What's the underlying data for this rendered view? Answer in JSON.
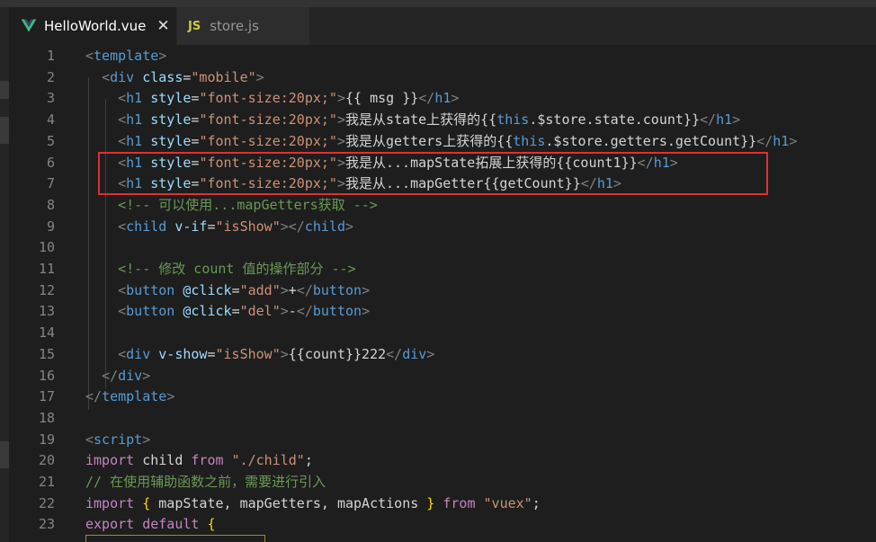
{
  "tabs": [
    {
      "label": "HelloWorld.vue",
      "icon": "vue-icon",
      "active": true,
      "close": "✕"
    },
    {
      "label": "store.js",
      "icon_text": "JS",
      "active": false
    }
  ],
  "colors": {
    "highlight_box": "#e03030",
    "vue_green": "#41b883",
    "js_yellow": "#cbcb41"
  },
  "lines": [
    {
      "n": "1",
      "tokens": [
        [
          "t-bracket",
          "<"
        ],
        [
          "t-tag",
          "template"
        ],
        [
          "t-bracket",
          ">"
        ]
      ]
    },
    {
      "n": "2",
      "tokens": [
        [
          "t-text",
          "  "
        ],
        [
          "t-bracket",
          "<"
        ],
        [
          "t-tag",
          "div"
        ],
        [
          "t-text",
          " "
        ],
        [
          "t-attr",
          "class"
        ],
        [
          "t-text",
          "="
        ],
        [
          "t-str",
          "\"mobile\""
        ],
        [
          "t-bracket",
          ">"
        ]
      ]
    },
    {
      "n": "3",
      "tokens": [
        [
          "t-text",
          "    "
        ],
        [
          "t-bracket",
          "<"
        ],
        [
          "t-tag",
          "h1"
        ],
        [
          "t-text",
          " "
        ],
        [
          "t-attr",
          "style"
        ],
        [
          "t-text",
          "="
        ],
        [
          "t-str",
          "\"font-size:20px;\""
        ],
        [
          "t-bracket",
          ">"
        ],
        [
          "t-text",
          "{{ msg }}"
        ],
        [
          "t-bracket",
          "</"
        ],
        [
          "t-tag",
          "h1"
        ],
        [
          "t-bracket",
          ">"
        ]
      ]
    },
    {
      "n": "4",
      "tokens": [
        [
          "t-text",
          "    "
        ],
        [
          "t-bracket",
          "<"
        ],
        [
          "t-tag",
          "h1"
        ],
        [
          "t-text",
          " "
        ],
        [
          "t-attr",
          "style"
        ],
        [
          "t-text",
          "="
        ],
        [
          "t-str",
          "\"font-size:20px;\""
        ],
        [
          "t-bracket",
          ">"
        ],
        [
          "t-text",
          "我是从state上获得的{{"
        ],
        [
          "t-kw",
          "this"
        ],
        [
          "t-text",
          ".$store.state.count}}"
        ],
        [
          "t-bracket",
          "</"
        ],
        [
          "t-tag",
          "h1"
        ],
        [
          "t-bracket",
          ">"
        ]
      ]
    },
    {
      "n": "5",
      "tokens": [
        [
          "t-text",
          "    "
        ],
        [
          "t-bracket",
          "<"
        ],
        [
          "t-tag",
          "h1"
        ],
        [
          "t-text",
          " "
        ],
        [
          "t-attr",
          "style"
        ],
        [
          "t-text",
          "="
        ],
        [
          "t-str",
          "\"font-size:20px;\""
        ],
        [
          "t-bracket",
          ">"
        ],
        [
          "t-text",
          "我是从getters上获得的{{"
        ],
        [
          "t-kw",
          "this"
        ],
        [
          "t-text",
          ".$store.getters.getCount}}"
        ],
        [
          "t-bracket",
          "</"
        ],
        [
          "t-tag",
          "h1"
        ],
        [
          "t-bracket",
          ">"
        ]
      ]
    },
    {
      "n": "6",
      "tokens": [
        [
          "t-text",
          "    "
        ],
        [
          "t-bracket",
          "<"
        ],
        [
          "t-tag",
          "h1"
        ],
        [
          "t-text",
          " "
        ],
        [
          "t-attr",
          "style"
        ],
        [
          "t-text",
          "="
        ],
        [
          "t-str",
          "\"font-size:20px;\""
        ],
        [
          "t-bracket",
          ">"
        ],
        [
          "t-text",
          "我是从...mapState拓展上获得的{{count1}}"
        ],
        [
          "t-bracket",
          "</"
        ],
        [
          "t-tag",
          "h1"
        ],
        [
          "t-bracket",
          ">"
        ]
      ]
    },
    {
      "n": "7",
      "tokens": [
        [
          "t-text",
          "    "
        ],
        [
          "t-bracket",
          "<"
        ],
        [
          "t-tag",
          "h1"
        ],
        [
          "t-text",
          " "
        ],
        [
          "t-attr",
          "style"
        ],
        [
          "t-text",
          "="
        ],
        [
          "t-str",
          "\"font-size:20px;\""
        ],
        [
          "t-bracket",
          ">"
        ],
        [
          "t-text",
          "我是从...mapGetter{{getCount}}"
        ],
        [
          "t-bracket",
          "</"
        ],
        [
          "t-tag",
          "h1"
        ],
        [
          "t-bracket",
          ">"
        ]
      ]
    },
    {
      "n": "8",
      "tokens": [
        [
          "t-text",
          "    "
        ],
        [
          "t-comment",
          "<!-- 可以使用...mapGetters获取 -->"
        ]
      ]
    },
    {
      "n": "9",
      "tokens": [
        [
          "t-text",
          "    "
        ],
        [
          "t-bracket",
          "<"
        ],
        [
          "t-tag",
          "child"
        ],
        [
          "t-text",
          " "
        ],
        [
          "t-attr",
          "v-if"
        ],
        [
          "t-text",
          "="
        ],
        [
          "t-str",
          "\"isShow\""
        ],
        [
          "t-bracket",
          "></"
        ],
        [
          "t-tag",
          "child"
        ],
        [
          "t-bracket",
          ">"
        ]
      ]
    },
    {
      "n": "10",
      "tokens": []
    },
    {
      "n": "11",
      "tokens": [
        [
          "t-text",
          "    "
        ],
        [
          "t-comment",
          "<!-- 修改 count 值的操作部分 -->"
        ]
      ]
    },
    {
      "n": "12",
      "tokens": [
        [
          "t-text",
          "    "
        ],
        [
          "t-bracket",
          "<"
        ],
        [
          "t-tag",
          "button"
        ],
        [
          "t-text",
          " "
        ],
        [
          "t-attr",
          "@click"
        ],
        [
          "t-text",
          "="
        ],
        [
          "t-str",
          "\"add\""
        ],
        [
          "t-bracket",
          ">"
        ],
        [
          "t-text",
          "+"
        ],
        [
          "t-bracket",
          "</"
        ],
        [
          "t-tag",
          "button"
        ],
        [
          "t-bracket",
          ">"
        ]
      ]
    },
    {
      "n": "13",
      "tokens": [
        [
          "t-text",
          "    "
        ],
        [
          "t-bracket",
          "<"
        ],
        [
          "t-tag",
          "button"
        ],
        [
          "t-text",
          " "
        ],
        [
          "t-attr",
          "@click"
        ],
        [
          "t-text",
          "="
        ],
        [
          "t-str",
          "\"del\""
        ],
        [
          "t-bracket",
          ">"
        ],
        [
          "t-text",
          "-"
        ],
        [
          "t-bracket",
          "</"
        ],
        [
          "t-tag",
          "button"
        ],
        [
          "t-bracket",
          ">"
        ]
      ]
    },
    {
      "n": "14",
      "tokens": []
    },
    {
      "n": "15",
      "tokens": [
        [
          "t-text",
          "    "
        ],
        [
          "t-bracket",
          "<"
        ],
        [
          "t-tag",
          "div"
        ],
        [
          "t-text",
          " "
        ],
        [
          "t-attr",
          "v-show"
        ],
        [
          "t-text",
          "="
        ],
        [
          "t-str",
          "\"isShow\""
        ],
        [
          "t-bracket",
          ">"
        ],
        [
          "t-text",
          "{{count}}222"
        ],
        [
          "t-bracket",
          "</"
        ],
        [
          "t-tag",
          "div"
        ],
        [
          "t-bracket",
          ">"
        ]
      ]
    },
    {
      "n": "16",
      "tokens": [
        [
          "t-text",
          "  "
        ],
        [
          "t-bracket",
          "</"
        ],
        [
          "t-tag",
          "div"
        ],
        [
          "t-bracket",
          ">"
        ]
      ]
    },
    {
      "n": "17",
      "tokens": [
        [
          "t-bracket",
          "</"
        ],
        [
          "t-tag",
          "template"
        ],
        [
          "t-bracket",
          ">"
        ]
      ]
    },
    {
      "n": "18",
      "tokens": []
    },
    {
      "n": "19",
      "tokens": [
        [
          "t-bracket",
          "<"
        ],
        [
          "t-tag",
          "script"
        ],
        [
          "t-bracket",
          ">"
        ]
      ]
    },
    {
      "n": "20",
      "tokens": [
        [
          "t-ctl",
          "import"
        ],
        [
          "t-text",
          " child "
        ],
        [
          "t-ctl",
          "from"
        ],
        [
          "t-text",
          " "
        ],
        [
          "t-str",
          "\"./child\""
        ],
        [
          "t-text",
          ";"
        ]
      ]
    },
    {
      "n": "21",
      "tokens": [
        [
          "t-comment",
          "// 在使用辅助函数之前，需要进行引入"
        ]
      ]
    },
    {
      "n": "22",
      "tokens": [
        [
          "t-ctl",
          "import"
        ],
        [
          "t-text",
          " "
        ],
        [
          "t-brace",
          "{"
        ],
        [
          "t-text",
          " mapState, mapGetters, mapActions "
        ],
        [
          "t-brace",
          "}"
        ],
        [
          "t-text",
          " "
        ],
        [
          "t-ctl",
          "from"
        ],
        [
          "t-text",
          " "
        ],
        [
          "t-str",
          "\"vuex\""
        ],
        [
          "t-text",
          ";"
        ]
      ]
    },
    {
      "n": "23",
      "tokens": [
        [
          "t-ctl",
          "export"
        ],
        [
          "t-text",
          " "
        ],
        [
          "t-ctl",
          "default"
        ],
        [
          "t-text",
          " "
        ],
        [
          "t-brace",
          "{"
        ]
      ]
    }
  ]
}
